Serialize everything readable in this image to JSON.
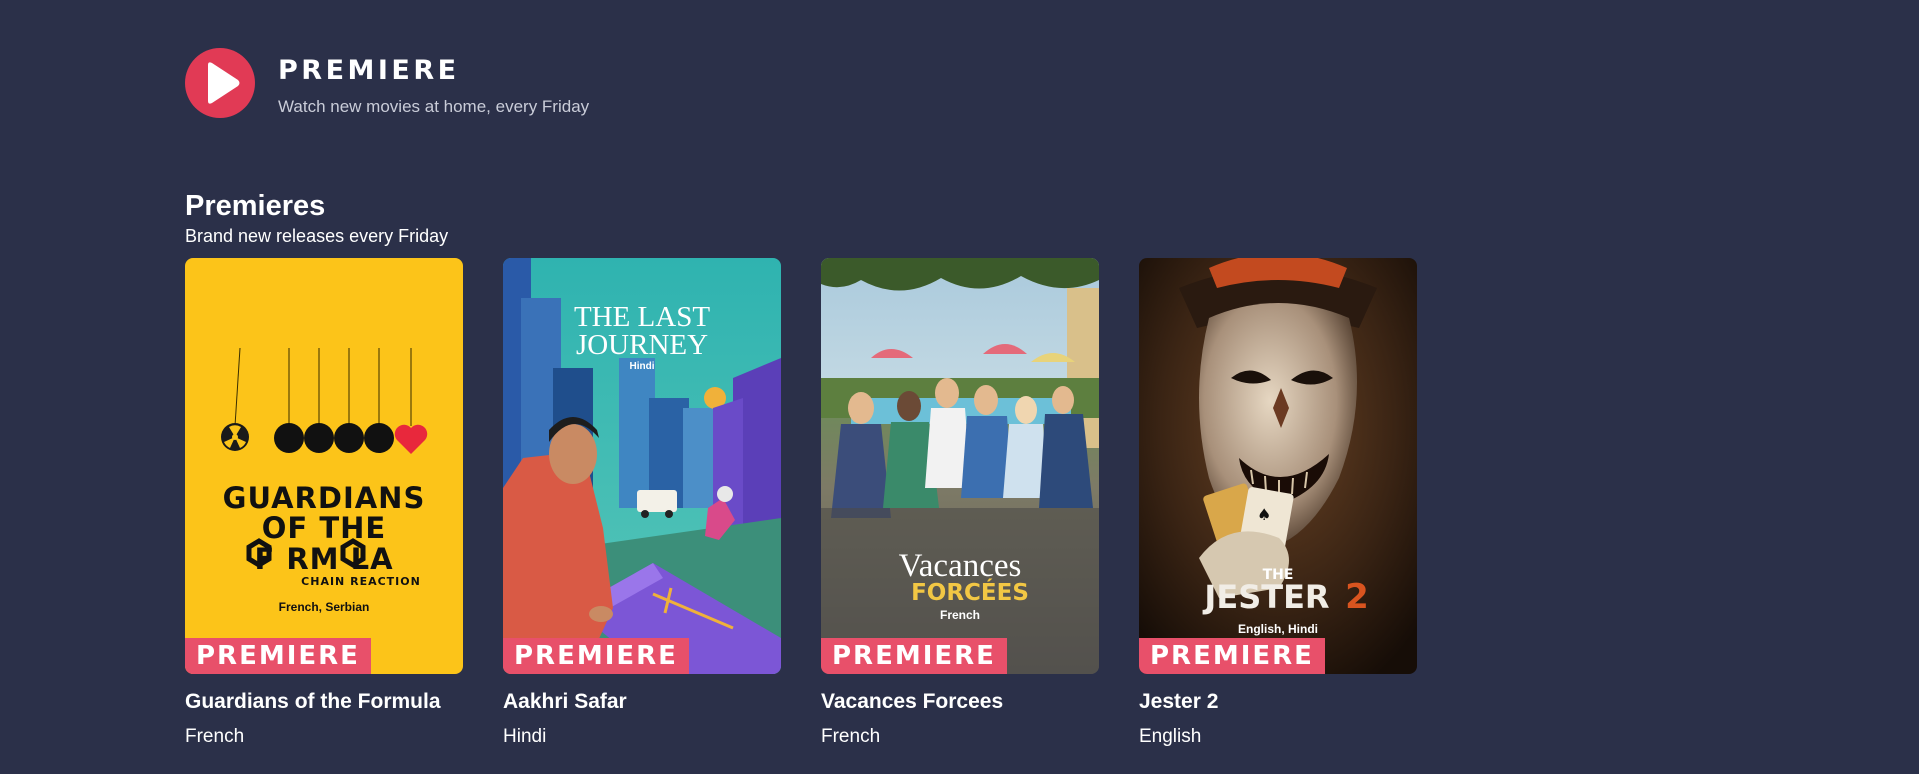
{
  "brand": {
    "title": "PREMIERE",
    "tagline": "Watch new movies at home, every Friday",
    "logo_icon": "play-icon",
    "accent_color": "#e13a55"
  },
  "section": {
    "title": "Premieres",
    "subtitle": "Brand new releases every Friday"
  },
  "badge_color": "#e8506a",
  "cards": [
    {
      "title": "Guardians of the Formula",
      "language": "French",
      "badge": "PREMIERE",
      "poster": {
        "title_line_1": "GUARDIANS",
        "title_line_2": "OF THE",
        "title_line_3": "F  RM LA",
        "tagline": "CHAIN REACTION",
        "languages": "French, Serbian",
        "background": "#fcc419"
      }
    },
    {
      "title": "Aakhri Safar",
      "language": "Hindi",
      "badge": "PREMIERE",
      "poster": {
        "title_line_1": "THE LAST",
        "title_line_2": "JOURNEY",
        "languages": "Hindi",
        "background": "#2fb3b0"
      }
    },
    {
      "title": "Vacances Forcees",
      "language": "French",
      "badge": "PREMIERE",
      "poster": {
        "title_line_1": "Vacances",
        "title_line_2": "FORCÉES",
        "languages": "French",
        "background": "#8fb3c9"
      }
    },
    {
      "title": "Jester 2",
      "language": "English",
      "badge": "PREMIERE",
      "poster": {
        "title_small": "THE",
        "title_main": "JESTER",
        "title_number": "2",
        "languages": "English, Hindi",
        "background": "#2a1a0f"
      }
    }
  ]
}
